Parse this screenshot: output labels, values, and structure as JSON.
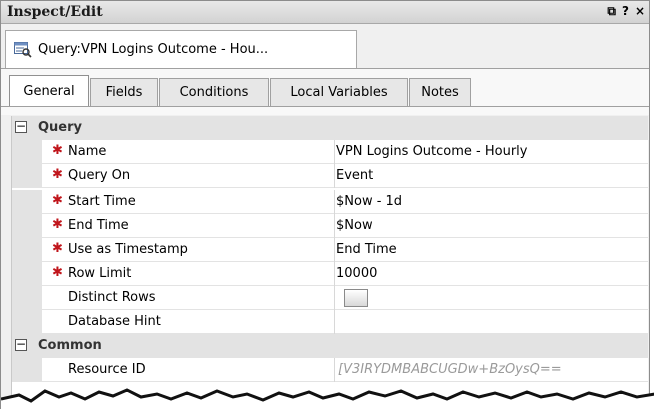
{
  "window": {
    "title": "Inspect/Edit",
    "titlebar_buttons": [
      "⧉",
      "?",
      "×"
    ]
  },
  "document_tab": {
    "icon": "query-icon",
    "label": "Query:VPN Logins Outcome - Hou..."
  },
  "tabs": [
    {
      "label": "General",
      "active": true
    },
    {
      "label": "Fields",
      "active": false
    },
    {
      "label": "Conditions",
      "active": false
    },
    {
      "label": "Local Variables",
      "active": false
    },
    {
      "label": "Notes",
      "active": false
    }
  ],
  "sections": {
    "query": {
      "toggle": "−",
      "label": "Query",
      "rows": [
        {
          "name": "Name",
          "required": true,
          "value": "VPN Logins Outcome - Hourly"
        },
        {
          "name": "Query On",
          "required": true,
          "value": "Event"
        },
        {
          "name": "Start Time",
          "required": true,
          "value": "$Now - 1d"
        },
        {
          "name": "End Time",
          "required": true,
          "value": "$Now"
        },
        {
          "name": "Use as Timestamp",
          "required": true,
          "value": "End Time"
        },
        {
          "name": "Row Limit",
          "required": true,
          "value": "10000"
        },
        {
          "name": "Distinct Rows",
          "required": false,
          "value": "",
          "checkbox": false
        },
        {
          "name": "Database Hint",
          "required": false,
          "value": ""
        }
      ]
    },
    "common": {
      "toggle": "−",
      "label": "Common",
      "rows": [
        {
          "name": "Resource ID",
          "required": false,
          "value": "[V3IRYDMBABCUGDw+BzOysQ=="
        }
      ]
    }
  },
  "required_marker": "✱",
  "colors": {
    "required": "#c0151b",
    "section_bg": "#e3e3e3",
    "muted_value": "#9a9a9a"
  }
}
